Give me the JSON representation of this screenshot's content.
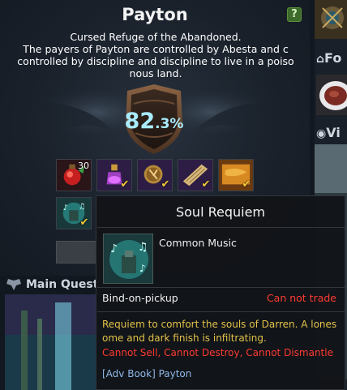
{
  "panel": {
    "title": "Payton",
    "help_label": "?",
    "description_lines": [
      "Cursed Refuge of the Abandoned.",
      "The payers of Payton are controlled by Abesta and c",
      "controlled by discipline and discipline to live in a poiso",
      "nous land."
    ],
    "percent_whole": "82",
    "percent_fraction": ".3",
    "percent_sign": "%",
    "progress_value": 82.3
  },
  "items": [
    {
      "name": "red-potion-item",
      "count": "30",
      "checked": false
    },
    {
      "name": "purple-potion-item",
      "count": "",
      "checked": true
    },
    {
      "name": "rune-stone-item",
      "count": "",
      "checked": true
    },
    {
      "name": "scroll-map-item",
      "count": "",
      "checked": true
    },
    {
      "name": "golden-parchment-item",
      "count": "",
      "checked": true
    },
    {
      "name": "soul-requiem-item",
      "count": "",
      "checked": true
    }
  ],
  "right_col": {
    "food_label": "Fo",
    "vi_label": "Vi"
  },
  "main_quest": {
    "label": "Main Quest"
  },
  "tooltip": {
    "title": "Soul Requiem",
    "type": "Common Music",
    "bind": "Bind-on-pickup",
    "trade": "Can not trade",
    "lore_lines": [
      "Requiem to comfort the souls of Darren. A lones",
      "ome and dark finish is infiltrating."
    ],
    "restrictions": [
      "Cannot Sell",
      "Cannot Destroy",
      "Cannot Dismantle"
    ],
    "source": "[Adv Book] Payton"
  },
  "colors": {
    "percent": "#a9ecff",
    "lore": "#e3c24a",
    "warning": "#ff3b33",
    "source": "#8fb8e8",
    "check": "#f3c83a"
  }
}
